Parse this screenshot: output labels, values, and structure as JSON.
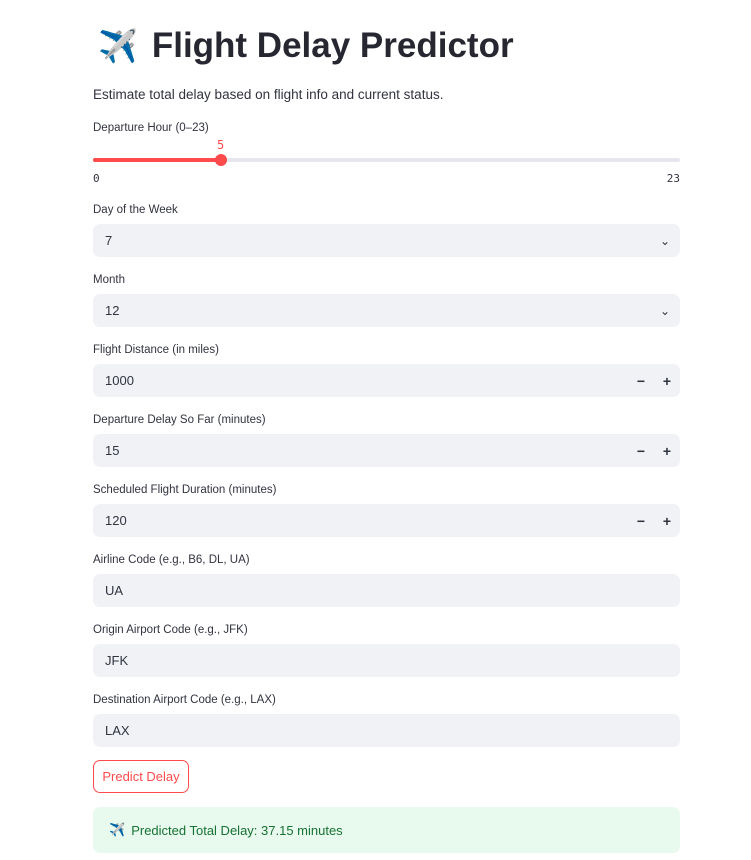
{
  "header": {
    "icon": "airplane-icon",
    "title": "Flight Delay Predictor",
    "subtitle": "Estimate total delay based on flight info and current status."
  },
  "slider": {
    "label": "Departure Hour (0–23)",
    "value": "5",
    "min": "0",
    "max": "23",
    "fraction": 0.2174,
    "accent": "#ff4b4b"
  },
  "fields": [
    {
      "label": "Day of the Week",
      "value": "7",
      "type": "select"
    },
    {
      "label": "Month",
      "value": "12",
      "type": "select"
    },
    {
      "label": "Flight Distance (in miles)",
      "value": "1000",
      "type": "number"
    },
    {
      "label": "Departure Delay So Far (minutes)",
      "value": "15",
      "type": "number"
    },
    {
      "label": "Scheduled Flight Duration (minutes)",
      "value": "120",
      "type": "number"
    },
    {
      "label": "Airline Code (e.g., B6, DL, UA)",
      "value": "UA",
      "type": "text"
    },
    {
      "label": "Origin Airport Code (e.g., JFK)",
      "value": "JFK",
      "type": "text"
    },
    {
      "label": "Destination Airport Code (e.g., LAX)",
      "value": "LAX",
      "type": "text"
    }
  ],
  "controls": {
    "minus": "−",
    "plus": "+",
    "chevron": "⌄"
  },
  "predict_button": "Predict Delay",
  "result": {
    "icon": "✈️",
    "text": "Predicted Total Delay: 37.15 minutes"
  }
}
